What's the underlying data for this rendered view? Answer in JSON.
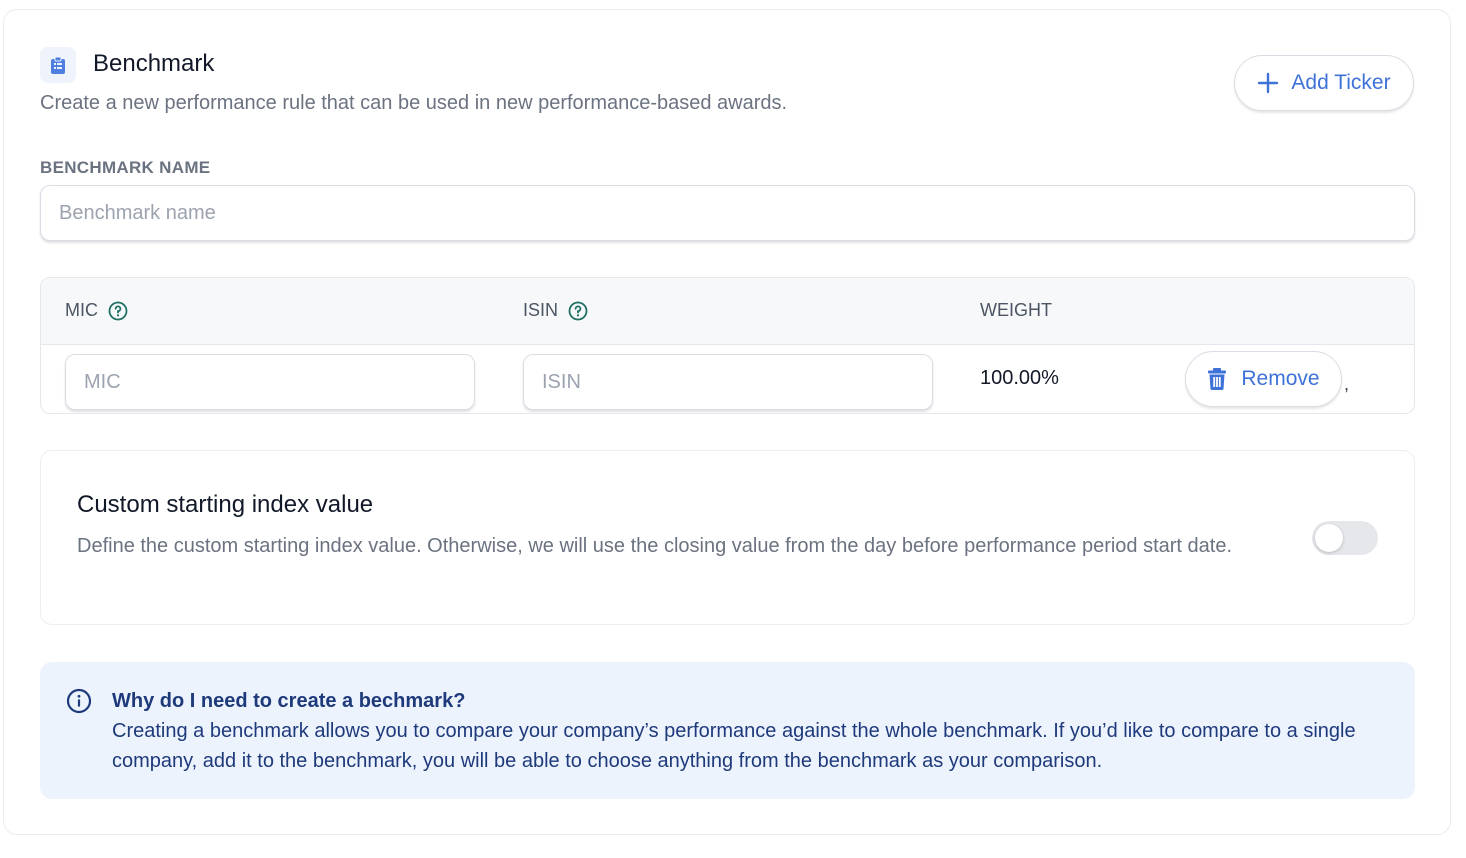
{
  "header": {
    "title": "Benchmark",
    "subtitle": "Create a new performance rule that can be used in new performance-based awards.",
    "icon": "clipboard-icon",
    "add_ticker_label": "Add Ticker"
  },
  "benchmark_name": {
    "label": "BENCHMARK NAME",
    "placeholder": "Benchmark name",
    "value": ""
  },
  "table": {
    "columns": [
      "MIC",
      "ISIN",
      "WEIGHT"
    ],
    "rows": [
      {
        "mic_placeholder": "MIC",
        "isin_placeholder": "ISIN",
        "weight": "100.00%",
        "remove_label": "Remove",
        "trailing": ","
      }
    ]
  },
  "custom_index": {
    "title": "Custom starting index value",
    "description": "Define the custom starting index value. Otherwise, we will use the closing value from the day before performance period start date.",
    "enabled": false
  },
  "info": {
    "title": "Why do I need to create a bechmark?",
    "body": "Creating a benchmark allows you to compare your company’s performance against the whole benchmark. If you’d like to compare to a single company, add it to the benchmark, you will be able to choose anything from the benchmark as your comparison."
  },
  "colors": {
    "accent": "#3f72d8",
    "help_icon": "#1f6f63",
    "info_bg": "#edf3fd",
    "info_text": "#1e3a7b"
  }
}
